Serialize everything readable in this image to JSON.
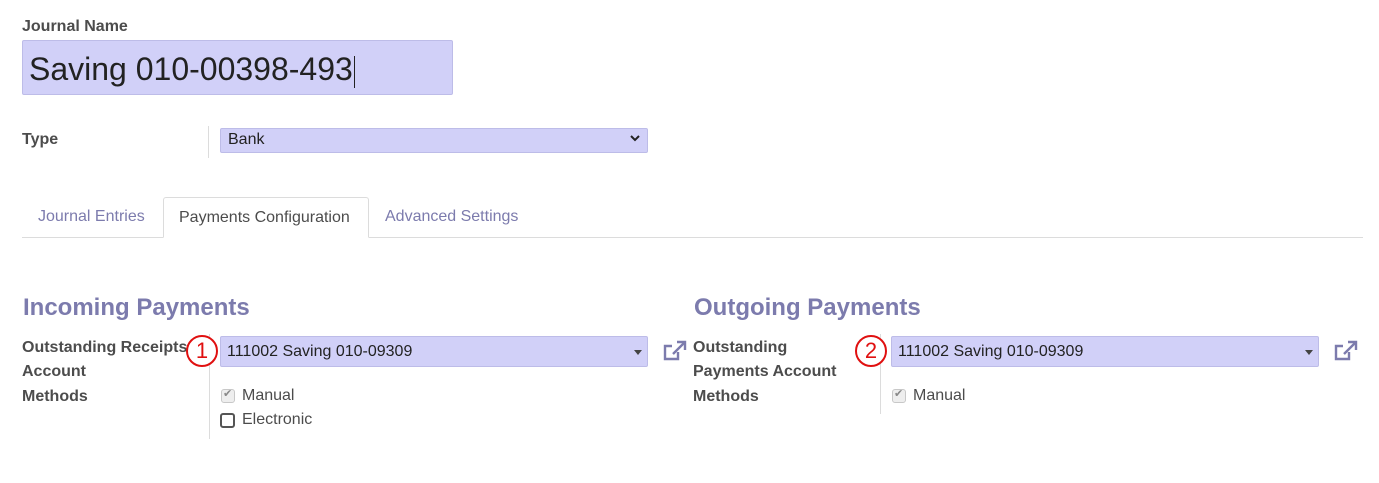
{
  "journal": {
    "name_label": "Journal Name",
    "name_value": "Saving 010-00398-493"
  },
  "type": {
    "label": "Type",
    "value": "Bank"
  },
  "tabs": [
    {
      "label": "Journal Entries",
      "active": false
    },
    {
      "label": "Payments Configuration",
      "active": true
    },
    {
      "label": "Advanced Settings",
      "active": false
    }
  ],
  "incoming": {
    "title": "Incoming Payments",
    "account_label_line1": "Outstanding Receipts",
    "account_label_line2": "Account",
    "account_value": "111002 Saving 010-09309",
    "badge": "1",
    "methods_label": "Methods",
    "methods": [
      {
        "label": "Manual",
        "checked": true,
        "disabled": true
      },
      {
        "label": "Electronic",
        "checked": false,
        "disabled": false
      }
    ]
  },
  "outgoing": {
    "title": "Outgoing Payments",
    "account_label_line1": "Outstanding",
    "account_label_line2": "Payments Account",
    "account_value": "111002 Saving 010-09309",
    "badge": "2",
    "methods_label": "Methods",
    "methods": [
      {
        "label": "Manual",
        "checked": true,
        "disabled": true
      }
    ]
  },
  "colors": {
    "accent": "#7c7bad",
    "field_bg": "#d1d0f8",
    "badge_red": "#e01010"
  },
  "icons": {
    "external_link": "external-link-icon",
    "select_chevron": "chevron-down-icon",
    "dropdown_caret": "caret-down-icon"
  }
}
